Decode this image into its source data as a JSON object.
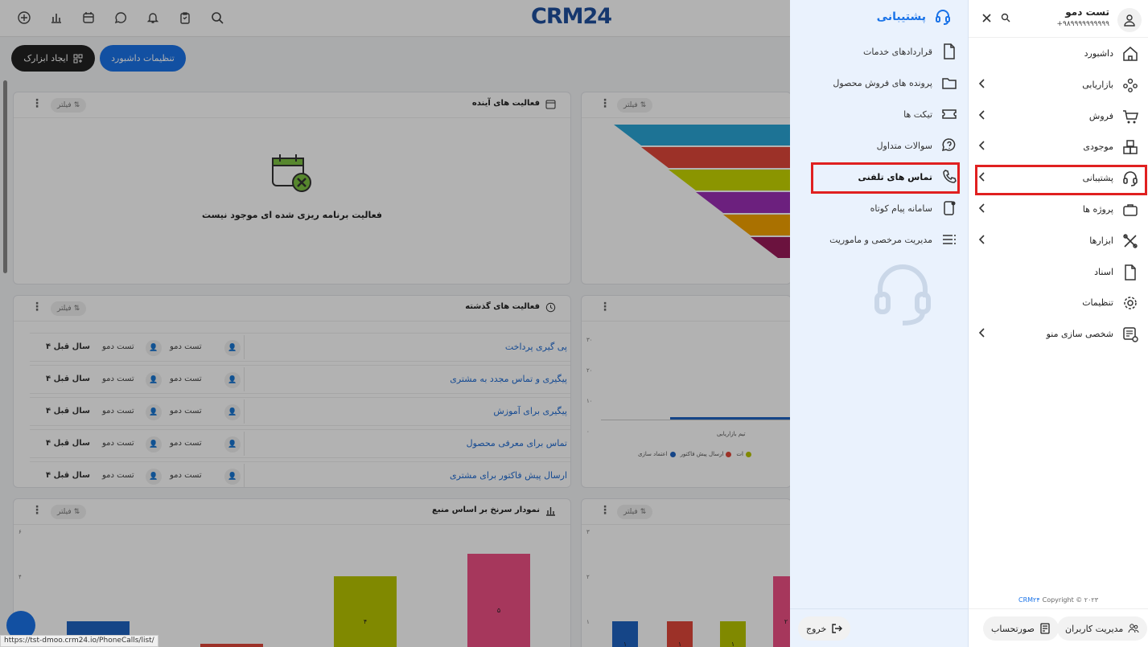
{
  "brand": {
    "logo": "CRM24"
  },
  "toolbar": {
    "dashboard_settings": "تنظیمات داشبورد",
    "create_widget": "ایجاد ابزارک"
  },
  "filter_label": "فیلتر",
  "cards": {
    "upcoming": {
      "title": "فعالیت های آینده",
      "empty_text": "فعالیت برنامه ریزی شده ای موجود نیست"
    },
    "past": {
      "title": "فعالیت های گذشته",
      "rows": [
        {
          "title": "پی گیری پرداخت",
          "user1": "تست دمو",
          "user2": "تست دمو",
          "ago": "۴ سال قبل"
        },
        {
          "title": "پیگیری و تماس مجدد به مشتری",
          "user1": "تست دمو",
          "user2": "تست دمو",
          "ago": "۴ سال قبل"
        },
        {
          "title": "پیگیری برای آموزش",
          "user1": "تست دمو",
          "user2": "تست دمو",
          "ago": "۴ سال قبل"
        },
        {
          "title": "تماس برای معرفی محصول",
          "user1": "تست دمو",
          "user2": "تست دمو",
          "ago": "۴ سال قبل"
        },
        {
          "title": "ارسال پیش فاکتور برای مشتری",
          "user1": "تست دمو",
          "user2": "تست دمو",
          "ago": "۴ سال قبل"
        }
      ]
    },
    "funnel_source": {
      "title": "نمودار سرنخ بر اساس منبع"
    },
    "team_chart": {
      "category": "تیم بازاریابی",
      "legend": [
        "اعتماد سازی",
        "ارسال پیش فاکتور",
        "ات"
      ],
      "yticks": [
        "۳۰",
        "۲۰",
        "۱۰",
        "۰"
      ]
    }
  },
  "chart_data": [
    {
      "type": "bar",
      "title": "نمودار سرنخ بر اساس منبع",
      "yticks": [
        "۶",
        "۴",
        "۲"
      ],
      "values": [
        2,
        1,
        4,
        5
      ],
      "colors": [
        "#1f63c2",
        "#e0473a",
        "#b8c400",
        "#ee4f85"
      ],
      "labels": [
        "۲",
        "۱",
        "۴",
        "۵"
      ]
    },
    {
      "type": "bar",
      "yticks": [
        "۳",
        "۲",
        "۱"
      ],
      "values": [
        1,
        1,
        1,
        2
      ],
      "colors": [
        "#1f63c2",
        "#e0473a",
        "#b8c400",
        "#ee4f85"
      ],
      "labels": [
        "۱",
        "۱",
        "۱",
        "۲"
      ]
    },
    {
      "type": "funnel",
      "colors": [
        "#2aa5d6",
        "#e0473a",
        "#c7d600",
        "#9b2fb5",
        "#f4a300",
        "#9a1b5a"
      ]
    }
  ],
  "status_url": "https://tst-dmoo.crm24.io/PhoneCalls/list/",
  "support_panel": {
    "title": "پشتیبانی",
    "items": [
      {
        "label": "قراردادهای خدمات",
        "icon": "document-icon"
      },
      {
        "label": "پرونده های فروش محصول",
        "icon": "folder-icon"
      },
      {
        "label": "تیکت ها",
        "icon": "ticket-icon"
      },
      {
        "label": "سوالات متداول",
        "icon": "faq-icon"
      },
      {
        "label": "تماس های تلفنی",
        "icon": "phone-icon",
        "active": true
      },
      {
        "label": "سامانه پیام کوتاه",
        "icon": "sms-icon"
      },
      {
        "label": "مدیریت مرخصی و ماموریت",
        "icon": "list-icon"
      }
    ],
    "logout": "خروج"
  },
  "user": {
    "name": "تست دمو",
    "phone": "+۹۸۹۹۹۹۹۹۹۹۹۹"
  },
  "main_menu": {
    "items": [
      {
        "label": "داشبورد",
        "icon": "home-icon",
        "chevron": false
      },
      {
        "label": "بازاریابی",
        "icon": "people-icon",
        "chevron": true
      },
      {
        "label": "فروش",
        "icon": "cart-icon",
        "chevron": true
      },
      {
        "label": "موجودی",
        "icon": "boxes-icon",
        "chevron": true
      },
      {
        "label": "پشتیبانی",
        "icon": "headset-icon",
        "chevron": true,
        "active": true
      },
      {
        "label": "پروژه ها",
        "icon": "briefcase-icon",
        "chevron": true
      },
      {
        "label": "ابزارها",
        "icon": "tools-icon",
        "chevron": true
      },
      {
        "label": "اسناد",
        "icon": "file-icon",
        "chevron": false
      },
      {
        "label": "تنظیمات",
        "icon": "gear-icon",
        "chevron": false
      },
      {
        "label": "شخصی سازی منو",
        "icon": "custom-menu-icon",
        "chevron": true
      }
    ],
    "copyright": "Copyright © ۲۰۲۳",
    "copyright_brand": "CRM۲۴",
    "user_management": "مدیریت کاربران",
    "invoice": "صورتحساب"
  },
  "colors": {
    "accent": "#1a73e8",
    "highlight": "#e02020",
    "panel": "#eaf2fd"
  }
}
